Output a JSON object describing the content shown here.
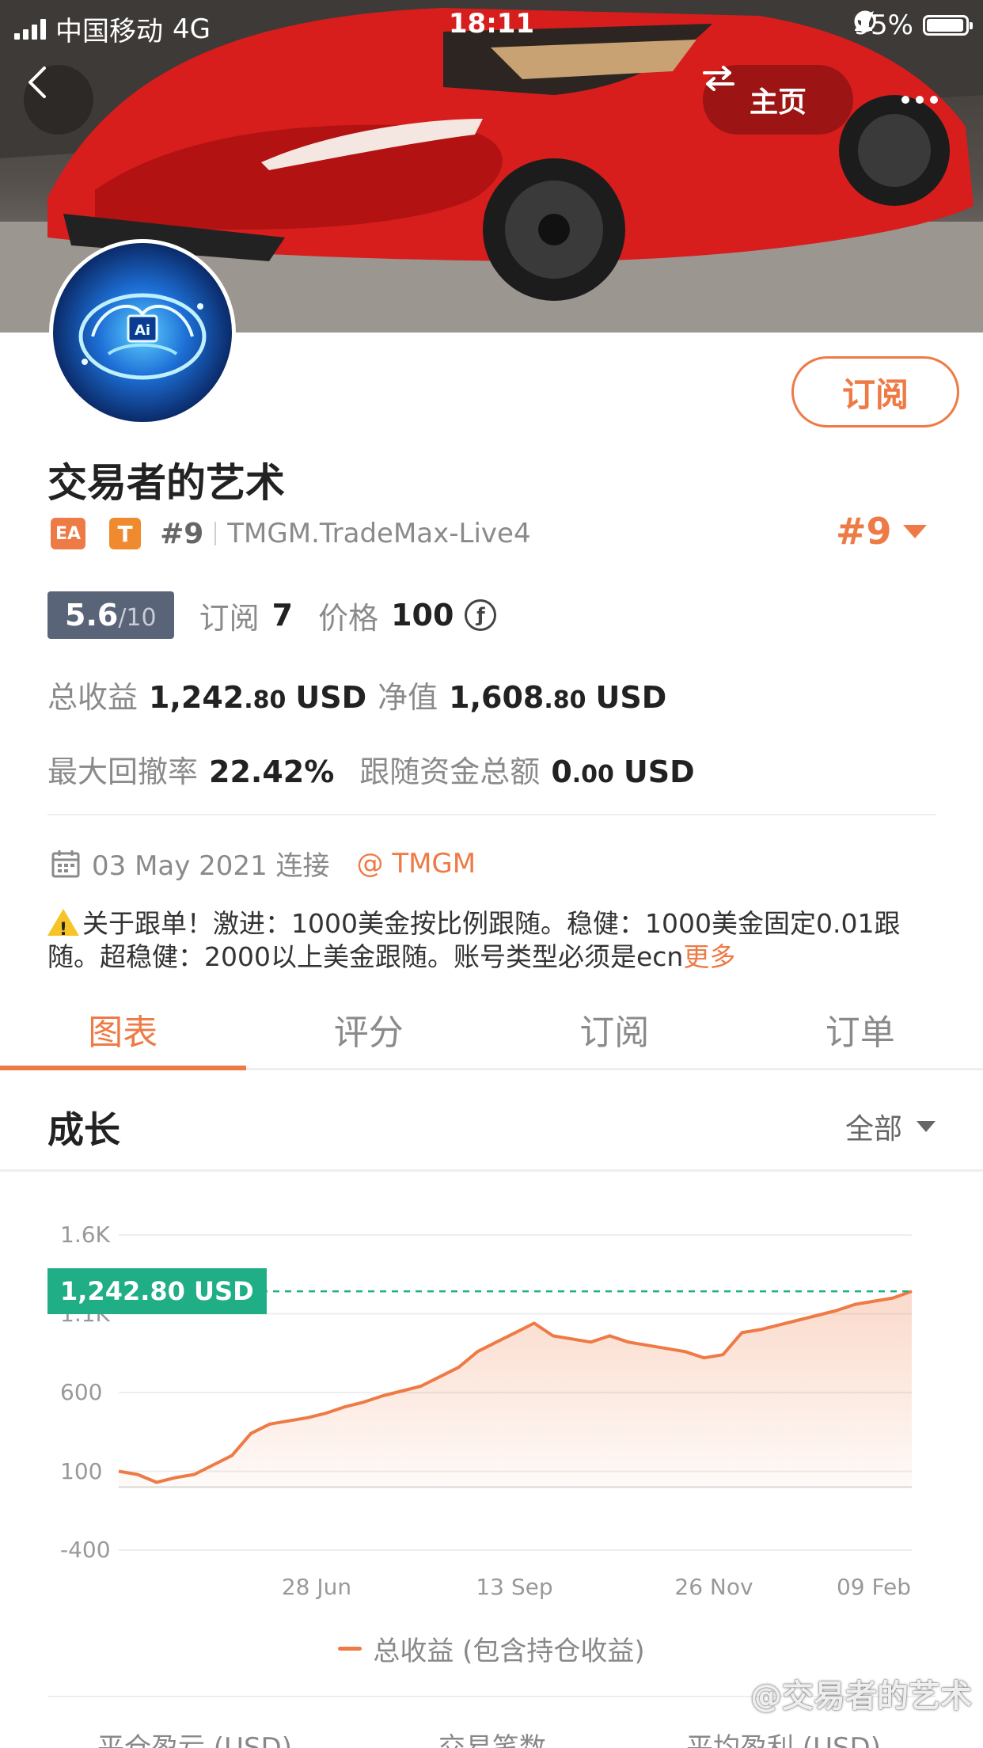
{
  "status_bar": {
    "carrier": "中国移动",
    "network": "4G",
    "time": "18:11",
    "battery": "95%"
  },
  "header": {
    "home_label": "主页"
  },
  "profile": {
    "name": "交易者的艺术",
    "badge_ea": "EA",
    "badge_t": "T",
    "rank": "#9",
    "server": "TMGM.TradeMax-Live4",
    "rank_right": "#9",
    "subscribe_label": "订阅"
  },
  "stats": {
    "score": "5.6",
    "score_max": "/10",
    "subscribe_label": "订阅",
    "subscribe_count": "7",
    "price_label": "价格",
    "price_value": "100",
    "price_coin": "ƒ",
    "total_profit_label": "总收益",
    "total_profit_int": "1,242",
    "total_profit_dec": ".80",
    "total_profit_cur": "USD",
    "equity_label": "净值",
    "equity_int": "1,608",
    "equity_dec": ".80",
    "equity_cur": "USD",
    "drawdown_label": "最大回撤率",
    "drawdown_value": "22.42%",
    "follow_label": "跟随资金总额",
    "follow_int": "0",
    "follow_dec": ".00",
    "follow_cur": "USD"
  },
  "connect": {
    "date": "03 May 2021 连接",
    "broker": "@ TMGM"
  },
  "description": {
    "text": "关于跟单！激进：1000美金按比例跟随。稳健：1000美金固定0.01跟随。超稳健：2000以上美金跟随。账号类型必须是ecn",
    "more": "更多"
  },
  "tabs": [
    {
      "label": "图表",
      "active": true
    },
    {
      "label": "评分",
      "active": false
    },
    {
      "label": "订阅",
      "active": false
    },
    {
      "label": "订单",
      "active": false
    }
  ],
  "growth": {
    "title": "成长",
    "filter": "全部"
  },
  "chart_data": {
    "type": "area",
    "y_ticks": [
      "1.6K",
      "1.1K",
      "600",
      "100",
      "-400"
    ],
    "x_ticks": [
      "28 Jun",
      "13 Sep",
      "26 Nov",
      "09 Feb"
    ],
    "ylim": [
      -400,
      1600
    ],
    "current_value_label": "1,242.80 USD",
    "current_value": 1242.8,
    "legend": "总收益 (包含持仓收益)",
    "color": "#ee7a45",
    "series": [
      {
        "name": "总收益 (包含持仓收益)",
        "x": [
          "2021-05-03",
          "2021-05-10",
          "2021-05-17",
          "2021-05-24",
          "2021-05-31",
          "2021-06-07",
          "2021-06-14",
          "2021-06-21",
          "2021-06-28",
          "2021-07-05",
          "2021-07-12",
          "2021-07-19",
          "2021-07-26",
          "2021-08-02",
          "2021-08-09",
          "2021-08-16",
          "2021-08-23",
          "2021-08-30",
          "2021-09-06",
          "2021-09-13",
          "2021-09-20",
          "2021-09-27",
          "2021-10-04",
          "2021-10-11",
          "2021-10-18",
          "2021-10-25",
          "2021-11-01",
          "2021-11-08",
          "2021-11-15",
          "2021-11-22",
          "2021-11-29",
          "2021-12-06",
          "2021-12-13",
          "2021-12-20",
          "2021-12-27",
          "2022-01-03",
          "2022-01-10",
          "2022-01-17",
          "2022-01-24",
          "2022-01-31",
          "2022-02-07",
          "2022-02-14",
          "2022-02-21"
        ],
        "values": [
          100,
          80,
          30,
          60,
          80,
          140,
          200,
          340,
          400,
          420,
          440,
          470,
          510,
          540,
          580,
          610,
          640,
          700,
          760,
          860,
          920,
          980,
          1040,
          960,
          940,
          920,
          960,
          920,
          900,
          880,
          860,
          820,
          840,
          980,
          1000,
          1030,
          1060,
          1090,
          1120,
          1160,
          1180,
          1200,
          1242.8
        ]
      }
    ]
  },
  "bottom_labels": [
    "平仓盈亏 (USD)",
    "交易笔数",
    "平均盈利 (USD)"
  ],
  "watermark": "@交易者的艺术",
  "colors": {
    "accent": "#ee7a45",
    "badge_green": "#1fae85",
    "score_bg": "#5a6478"
  }
}
